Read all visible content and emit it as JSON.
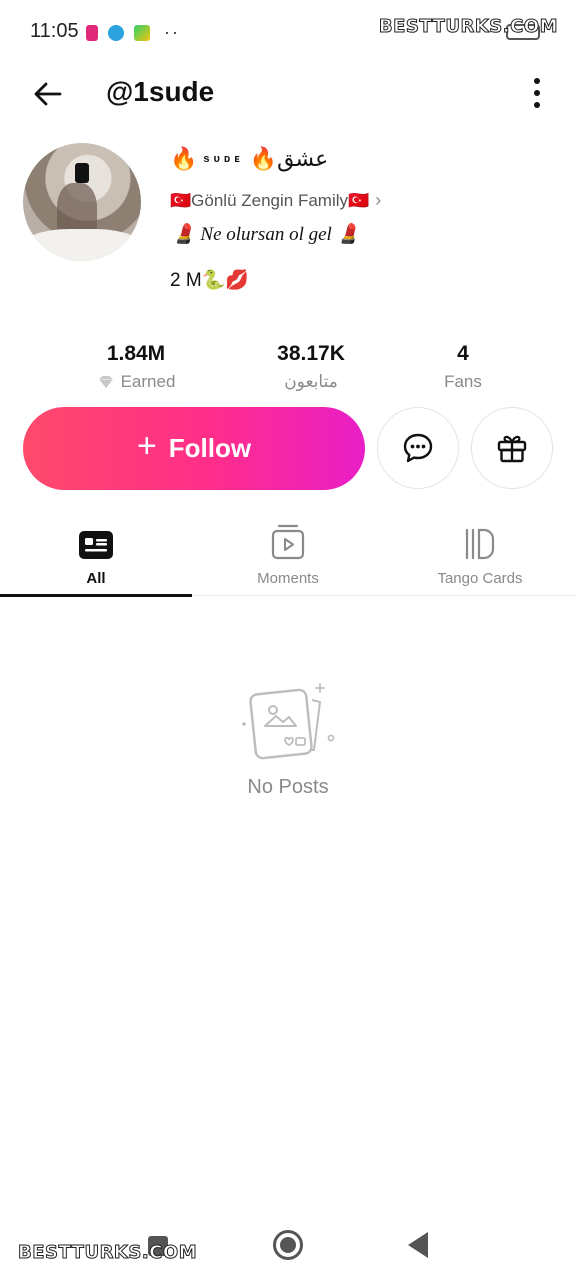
{
  "status_bar": {
    "time": "11:05",
    "more": "··",
    "watermark_top": "BESTTURKS.COM",
    "icons": [
      "tango-icon",
      "telegram-icon",
      "app-icon"
    ]
  },
  "header": {
    "username": "@1sude"
  },
  "profile": {
    "name_prefix": "🔥",
    "name_small": "ѕᴜᴅᴇ",
    "name_suffix": "🔥عشق",
    "family": "🇹🇷Gönlü Zengin Family🇹🇷",
    "family_chevron": "›",
    "bio": "💄 Ne olursan ol gel 💄",
    "extra": "2 M🐍💋"
  },
  "stats": [
    {
      "value": "1.84M",
      "label": "Earned"
    },
    {
      "value": "38.17K",
      "label": "متابعون"
    },
    {
      "value": "4",
      "label": "Fans"
    }
  ],
  "actions": {
    "follow_plus": "+",
    "follow_label": "Follow"
  },
  "tabs": [
    {
      "label": "All",
      "active": true
    },
    {
      "label": "Moments",
      "active": false
    },
    {
      "label": "Tango Cards",
      "active": false
    }
  ],
  "empty": {
    "text": "No Posts"
  },
  "footer": {
    "watermark_bottom": "BESTTURKS.COM"
  },
  "colors": {
    "follow_gradient_start": "#ff4a6b",
    "follow_gradient_end": "#e91fc8",
    "active_tab": "#111111",
    "muted": "#8a8a8a"
  }
}
